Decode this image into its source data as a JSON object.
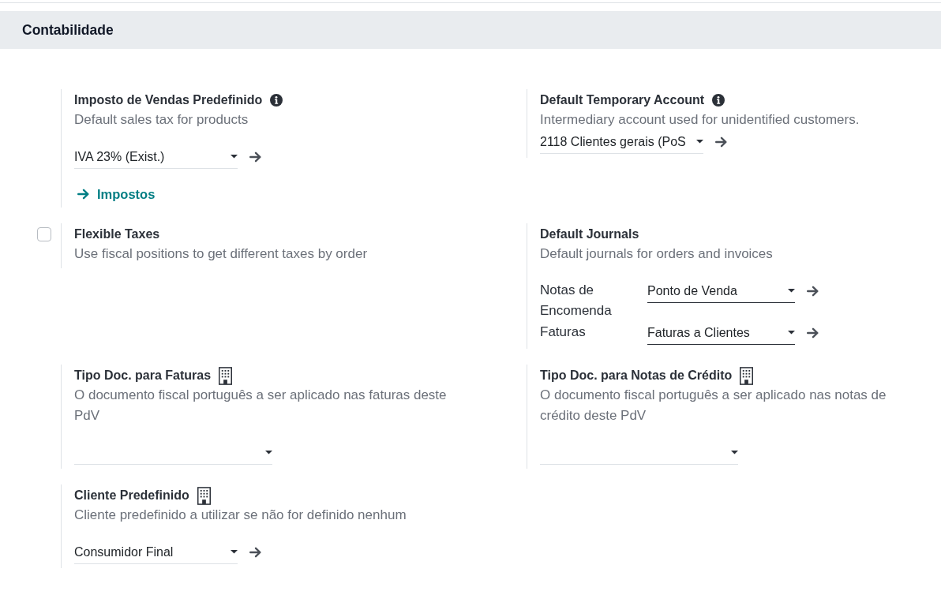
{
  "section": {
    "title": "Contabilidade"
  },
  "settings": [
    {
      "kind": "field",
      "title": "Imposto de Vendas Predefinido",
      "title_icon": {
        "kind": "info"
      },
      "description": "Default sales tax for products",
      "fields": [
        {
          "value": "IVA 23% (Exist.)",
          "required": false,
          "open_button": true
        }
      ],
      "link": {
        "label": "Impostos"
      }
    },
    {
      "kind": "field",
      "title": "Default Temporary Account",
      "title_icon": {
        "kind": "info"
      },
      "description": "Intermediary account used for unidentified customers.",
      "fields": [
        {
          "value": "2118 Clientes gerais (PoS",
          "required": false,
          "open_button": true
        }
      ]
    },
    {
      "kind": "checkbox",
      "checked": false,
      "title": "Flexible Taxes",
      "description": "Use fiscal positions to get different taxes by order"
    },
    {
      "kind": "field",
      "title": "Default Journals",
      "description": "Default journals for orders and invoices",
      "fields": [
        {
          "label": "Notas de Encomenda",
          "value": "Ponto de Venda",
          "required": true,
          "open_button": true
        },
        {
          "label": "Faturas",
          "value": "Faturas a Clientes",
          "required": true,
          "open_button": true
        }
      ]
    },
    {
      "kind": "field",
      "title": "Tipo Doc. para Faturas",
      "title_icon": {
        "kind": "building"
      },
      "description": "O documento fiscal português a ser aplicado nas faturas deste PdV",
      "fields": [
        {
          "required": false,
          "open_button": false
        }
      ]
    },
    {
      "kind": "field",
      "title": "Tipo Doc. para Notas de Crédito",
      "title_icon": {
        "kind": "building"
      },
      "description": "O documento fiscal português a ser aplicado nas notas de crédito deste PdV",
      "fields": [
        {
          "required": false,
          "open_button": false
        }
      ]
    },
    {
      "kind": "field",
      "title": "Cliente Predefinido",
      "title_icon": {
        "kind": "building"
      },
      "description": "Cliente predefinido a utilizar se não for definido nenhum",
      "fields": [
        {
          "value": "Consumidor Final",
          "required": false,
          "open_button": true
        }
      ]
    }
  ]
}
